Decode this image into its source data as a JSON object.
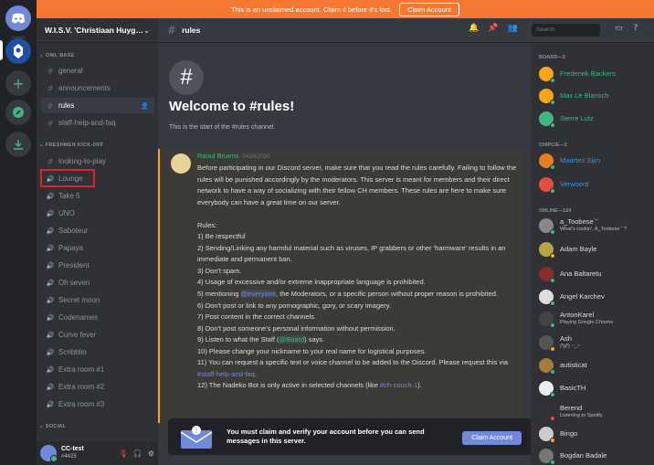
{
  "banner": {
    "text": "This is an unclaimed account. Claim it before it's lost.",
    "button": "Claim Account"
  },
  "server": {
    "name": "W.I.S.V. 'Christiaan Huyg…"
  },
  "categories": {
    "owl": "OWL BASE",
    "freshmen": "FRESHMEN KICK-OFF",
    "social": "SOCIAL"
  },
  "channels": {
    "general": "general",
    "announcements": "announcements",
    "rules": "rules",
    "help": "staff-help-and-faq",
    "looking": "looking-to-play",
    "voice": [
      "Lounge",
      "Take 5",
      "UNO",
      "Saboteur",
      "Papaya",
      "President",
      "Oh seven",
      "Secret moon",
      "Codenames",
      "Curve fever",
      "Scribblio",
      "Extra room #1",
      "Extra room #2",
      "Extra room #3"
    ]
  },
  "user": {
    "name": "CC-test",
    "tag": "#4425"
  },
  "header": {
    "channel": "rules",
    "search_placeholder": "Search"
  },
  "welcome": {
    "title": "Welcome to #rules!",
    "subtitle": "This is the start of the #rules channel."
  },
  "message": {
    "author": "Raoul Bruens",
    "date": "04/28/2020",
    "intro": "Before participating in our Discord server, make sure that you read the rules carefully. Failing to follow the rules will be punished accordingly by the moderators. This server is meant for members and their direct network to have a way of socializing with their fellow CH members. These rules are here to make sure everybody can have a great time on our server.",
    "rules_heading": "Rules:",
    "r1": "1) Be respectful",
    "r2": "2) Sending/Linking any harmful material such as viruses, IP grabbers or other 'harmware' results in an immediate and permanent ban.",
    "r3": "3) Don't spam.",
    "r4": "4) Usage of excessive and/or extreme inappropriate language is prohibited.",
    "r5a": "5) mentioning ",
    "r5m": "@everyone",
    "r5b": ", the Moderators, or a specific person without proper reason is prohibited.",
    "r6": "6) Don't post or link to any pornographic, gory, or scary imagery.",
    "r7": "7) Post content in the correct channels.",
    "r8": "8) Don't post someone's personal information without permission.",
    "r9a": "9) Listen to what the Staff (",
    "r9m": "@Board",
    "r9b": ") says.",
    "r10": "10) Please change your nickname to your real name for logistical purposes.",
    "r11a": "11) You can request a specific text or voice channel to be added to the Discord. Please request this via ",
    "r11l": "#staff-help-and-faq",
    "r11b": ".",
    "r12a": "12) The Nadeko Bot is only active in selected channels (like ",
    "r12l": "#ch-couch-1",
    "r12b": ")."
  },
  "claim": {
    "text": "You must claim and verify your account before you can send messages in this server.",
    "button": "Claim Account"
  },
  "member_categories": {
    "board": "BOARD—3",
    "chipcie": "CHIPCIE—2",
    "online": "ONLINE—124"
  },
  "members": [
    {
      "name": "Frederiek Backers",
      "status": "",
      "color": "#43b581"
    },
    {
      "name": "Max Le Blansch",
      "status": "",
      "color": "#43b581"
    },
    {
      "name": "Sterre Lutz",
      "status": "",
      "color": "#43b581"
    },
    {
      "name": "Maarten Sijm",
      "status": "",
      "color": "#3498db"
    },
    {
      "name": "Verwoerd",
      "status": "",
      "color": "#3498db"
    },
    {
      "name": "a_Toobese`'`",
      "status": "What's cookin', A_Toobese`'`?",
      "color": "#dcddde"
    },
    {
      "name": "Adam Bayle",
      "status": "",
      "color": "#dcddde"
    },
    {
      "name": "Ana Baltaretu",
      "status": "",
      "color": "#dcddde"
    },
    {
      "name": "Angel Karchev",
      "status": "",
      "color": "#dcddde"
    },
    {
      "name": "AntonKarel",
      "status": "Playing Google Chrome",
      "color": "#dcddde"
    },
    {
      "name": "Ash",
      "status": "(ºдº)  ~_~",
      "color": "#dcddde"
    },
    {
      "name": "autisticat",
      "status": "",
      "color": "#dcddde"
    },
    {
      "name": "BasicTH",
      "status": "",
      "color": "#dcddde"
    },
    {
      "name": "Berend",
      "status": "Listening to Spotify",
      "color": "#dcddde"
    },
    {
      "name": "Bingo",
      "status": "",
      "color": "#dcddde"
    },
    {
      "name": "Bogdan Badale",
      "status": "",
      "color": "#dcddde"
    }
  ]
}
